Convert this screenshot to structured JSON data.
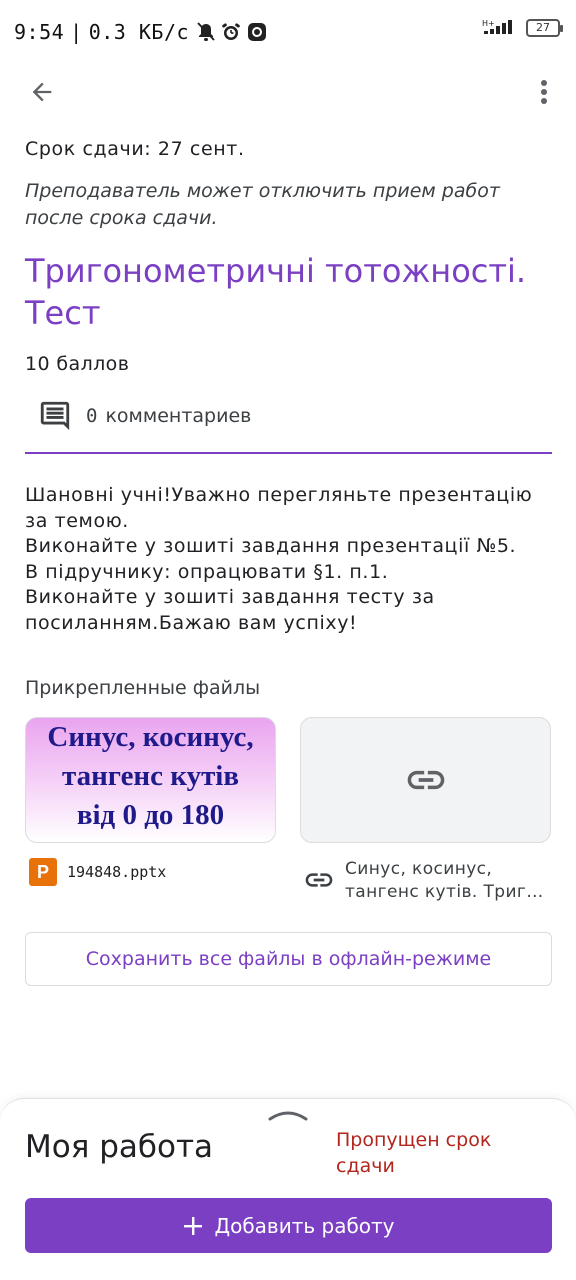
{
  "status_bar": {
    "time": "9:54",
    "speed": "0.3 КБ/с",
    "battery": "27"
  },
  "header": {
    "back_icon": "arrow-back-icon",
    "menu_icon": "more-vert-icon"
  },
  "assignment": {
    "due": "Срок сдачи: 27 сент.",
    "note": "Преподаватель может отключить прием работ после срока сдачи.",
    "title": "Тригонометричні тотожності. Тест",
    "points": "10 баллов",
    "comments_count": "0",
    "comments_label": "комментариев",
    "description": [
      "Шановні учні!Уважно перегляньте презентацію",
      "за темою.",
      "Виконайте у зошиті завдання презентації №5.",
      "В підручнику: опрацювати §1. п.1.",
      "Виконайте у зошиті завдання тесту за",
      "посиланням.Бажаю вам успіху!"
    ]
  },
  "attachments": {
    "label": "Прикрепленные файлы",
    "ppt_preview_lines": [
      "Синус, косинус,",
      "тангенс кутів",
      "від 0 до 180"
    ],
    "ppt_icon_letter": "P",
    "ppt_name": "194848.pptx",
    "link_name_lines": [
      "Синус, косинус,",
      "тангенс кутів. Триг…"
    ],
    "offline_button": "Сохранить все файлы в офлайн-режиме"
  },
  "my_work": {
    "title": "Моя работа",
    "status": "Пропущен срок сдачи",
    "add_button": "Добавить работу"
  },
  "colors": {
    "accent": "#7b3fc4",
    "missed": "#b3261e",
    "ppt_icon": "#e8710a"
  }
}
